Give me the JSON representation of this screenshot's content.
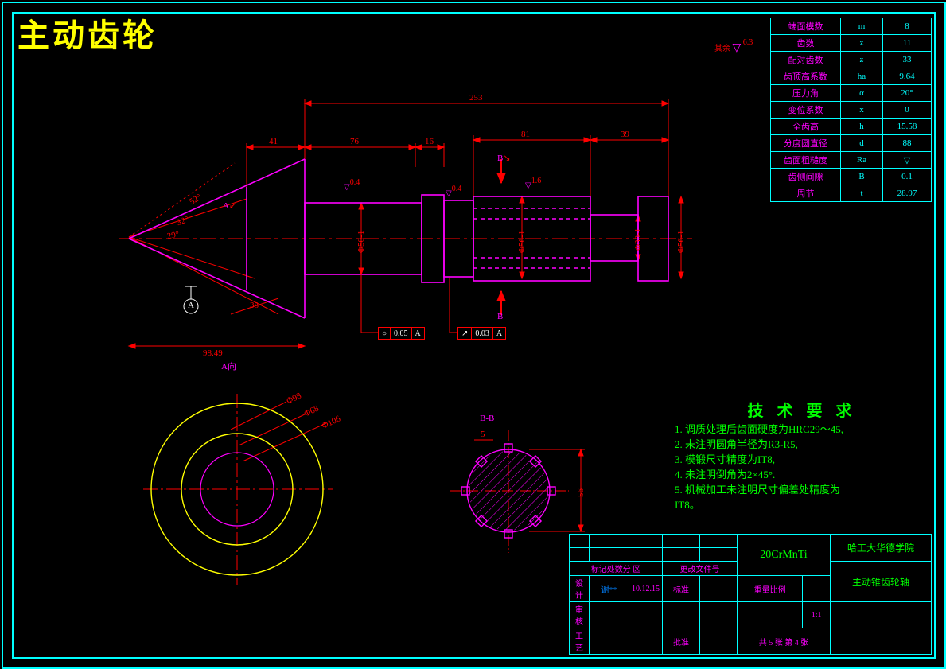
{
  "title": "主动齿轮",
  "surface_other": "其余",
  "surface_other_val": "6.3",
  "params": [
    {
      "name": "端面模数",
      "sym": "m",
      "val": "8"
    },
    {
      "name": "齿数",
      "sym": "z",
      "val": "11"
    },
    {
      "name": "配对齿数",
      "sym": "z",
      "val": "33"
    },
    {
      "name": "齿顶高系数",
      "sym": "ha",
      "val": "9.64"
    },
    {
      "name": "压力角",
      "sym": "α",
      "val": "20°"
    },
    {
      "name": "变位系数",
      "sym": "x",
      "val": "0"
    },
    {
      "name": "全齿高",
      "sym": "h",
      "val": "15.58"
    },
    {
      "name": "分度圆直径",
      "sym": "d",
      "val": "88"
    },
    {
      "name": "齿面粗糙度",
      "sym": "Ra",
      "val": "▽"
    },
    {
      "name": "齿侧间隙",
      "sym": "B",
      "val": "0.1"
    },
    {
      "name": "周节",
      "sym": "t",
      "val": "28.97"
    }
  ],
  "dims": {
    "len_total": "253",
    "len_41": "41",
    "len_76": "76",
    "len_16": "16",
    "len_81": "81",
    "len_39": "39",
    "len_38": "38",
    "len_98": "98.49",
    "dia_50": "Φ50-1",
    "dia_56": "Φ56-1",
    "dia_30": "Φ30-1",
    "dia_56b": "Φ56-1",
    "ang_52": "52°",
    "ang_32": "32°",
    "ang_29": "29°",
    "view_a": "A向",
    "sec_b": "B",
    "sec_bb": "B-B",
    "circ_98": "Φ98",
    "circ_68": "Φ68",
    "circ_106": "Φ106",
    "bb_56": "56",
    "bb_5": "5"
  },
  "gtol1": {
    "sym": "○",
    "val": "0.05",
    "ref": "A"
  },
  "gtol2": {
    "sym": "↗",
    "val": "0.03",
    "ref": "A"
  },
  "datum": "A",
  "surf_small": "0.4",
  "surf_small2": "0.4",
  "surf_small3": "1.6",
  "tech": {
    "title": "技 术 要 求",
    "lines": [
      "1. 调质处理后齿面硬度为HRC29～45,",
      "2. 未注明圆角半径为R3-R5,",
      "3. 模锻尺寸精度为IT8,",
      "4. 未注明倒角为2×45°.",
      "5. 机械加工未注明尺寸偏差处精度为",
      "IT8。"
    ]
  },
  "titleblock": {
    "material": "20CrMnTi",
    "school": "哈工大华德学院",
    "part": "主动锥齿轮轴",
    "scale_lbl": "重量比例",
    "scale": "1:1",
    "sheets": "共 5 张   第 4 张",
    "mark": "标记处数分 区",
    "design": "设计",
    "date": "10.12.15",
    "check": "审核",
    "std": "标准",
    "tech": "工艺",
    "appr": "批准"
  }
}
